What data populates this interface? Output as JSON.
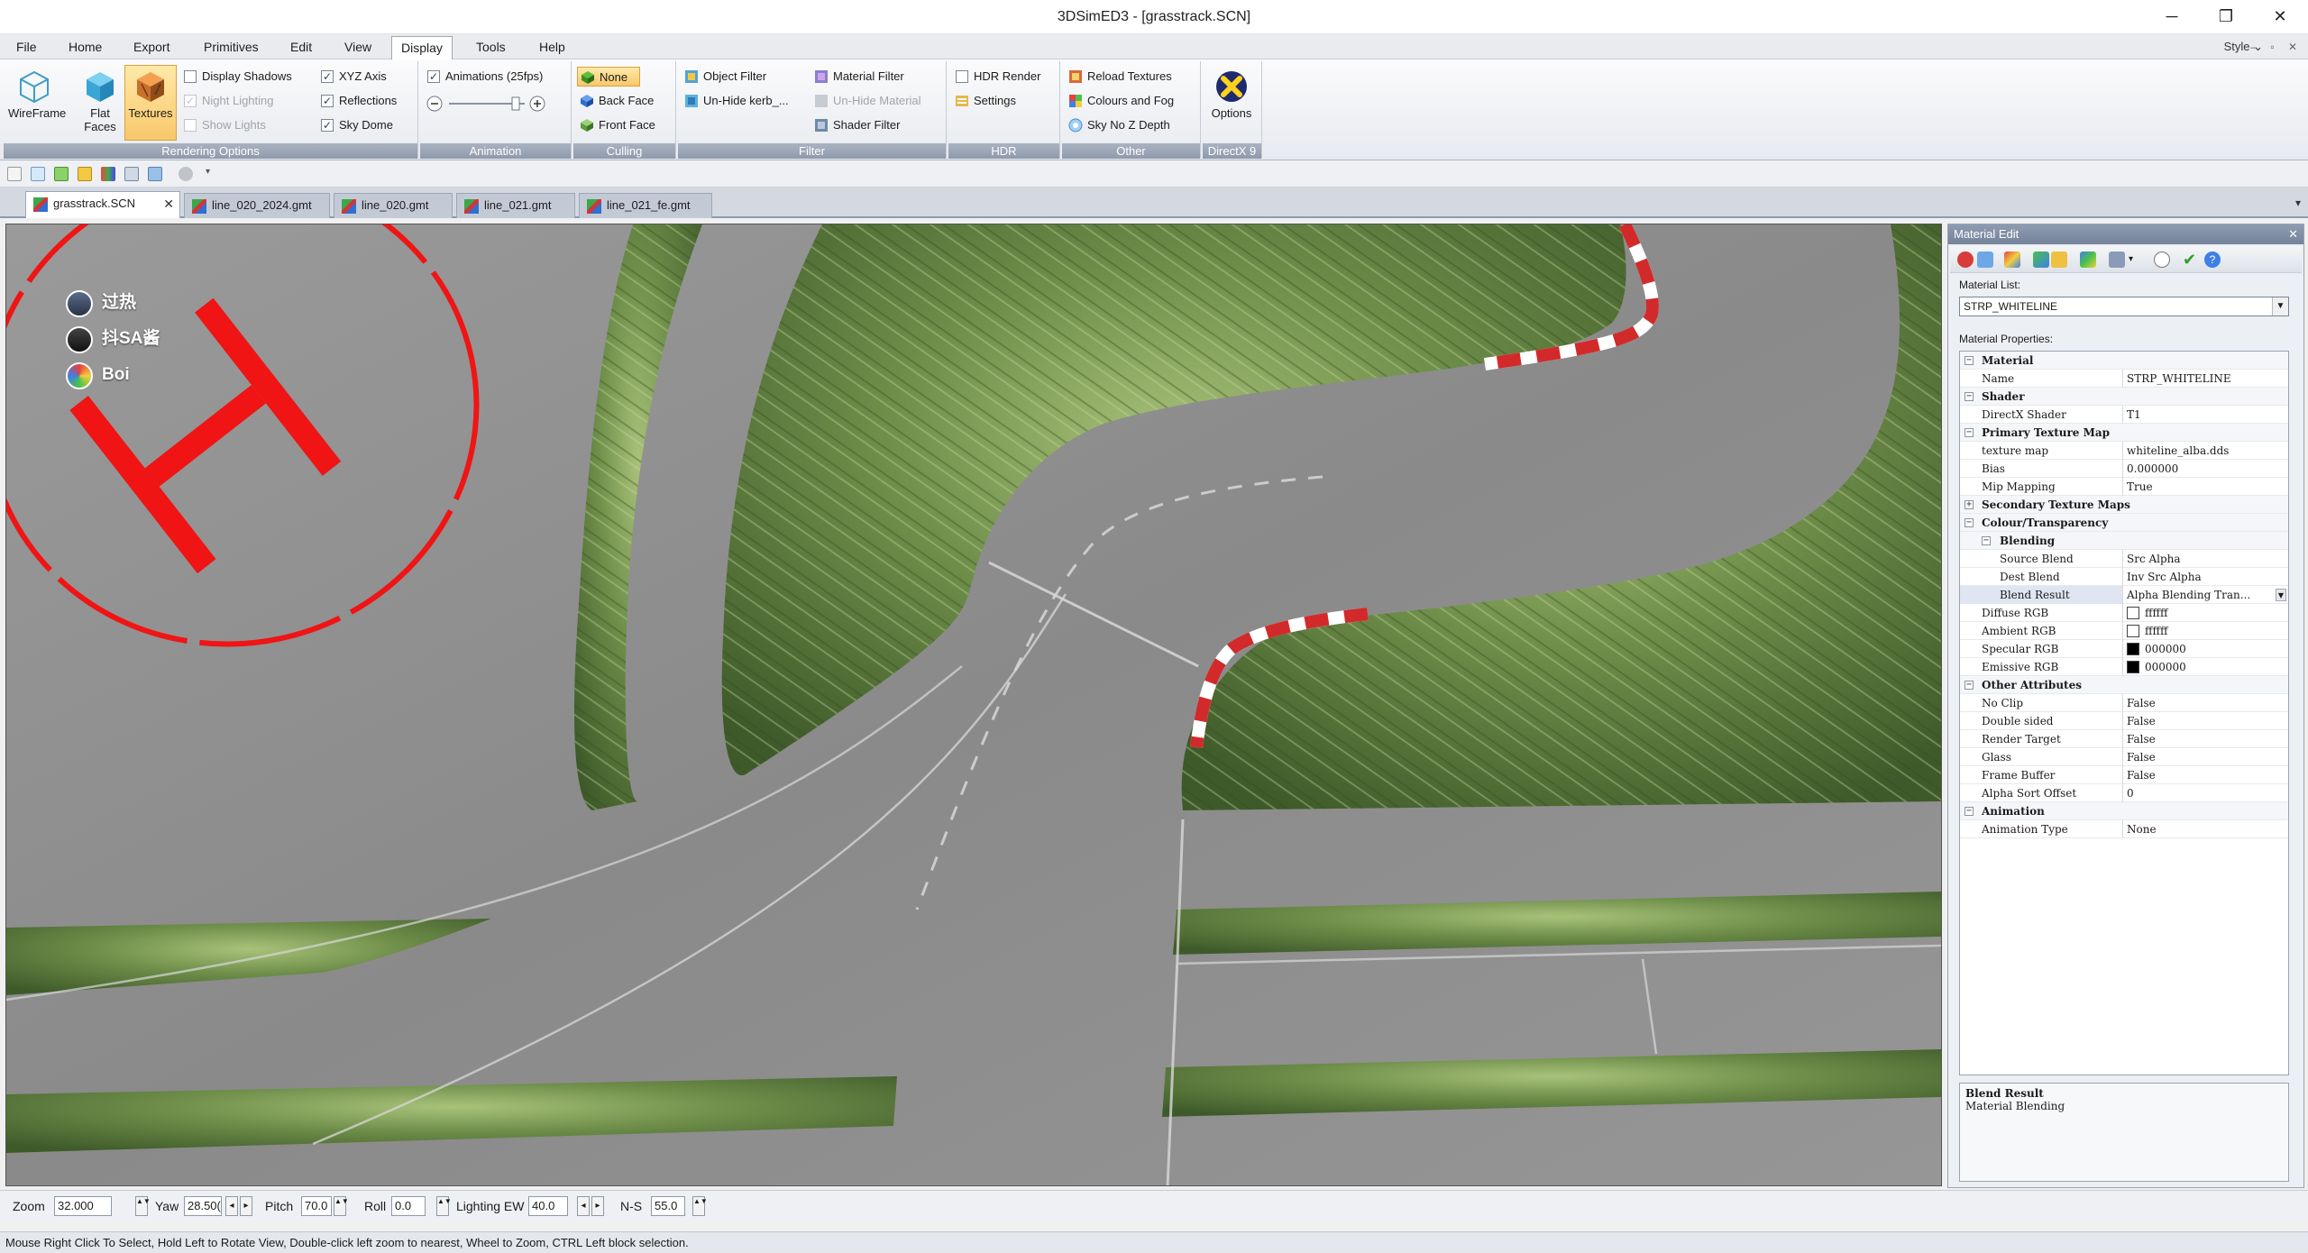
{
  "window": {
    "title": "3DSimED3 - [grasstrack.SCN]",
    "minimize": "─",
    "restore": "❐",
    "close": "✕"
  },
  "menu": {
    "items": [
      "File",
      "Home",
      "Export",
      "Primitives",
      "Edit",
      "View",
      "Display",
      "Tools",
      "Help"
    ],
    "active": "Display",
    "style_label": "Style",
    "style_arrow": "⌄",
    "mini_controls": "‒ ▫ ✕"
  },
  "ribbon": {
    "rendering_options": {
      "label": "Rendering Options",
      "wireframe": "WireFrame",
      "flat_faces": "Flat Faces",
      "textures": "Textures",
      "display_shadows": "Display Shadows",
      "night_lighting": "Night Lighting",
      "show_lights": "Show Lights",
      "xyz_axis": "XYZ Axis",
      "reflections": "Reflections",
      "sky_dome": "Sky Dome",
      "check": "✓"
    },
    "animation": {
      "label": "Animation",
      "animations": "Animations (25fps)"
    },
    "culling": {
      "label": "Culling",
      "none": "None",
      "back_face": "Back Face",
      "front_face": "Front Face"
    },
    "filter": {
      "label": "Filter",
      "object_filter": "Object Filter",
      "unhide_kerb": "Un-Hide kerb_...",
      "material_filter": "Material Filter",
      "unhide_material": "Un-Hide Material",
      "shader_filter": "Shader Filter"
    },
    "hdr": {
      "label": "HDR",
      "hdr_render": "HDR Render",
      "settings": "Settings"
    },
    "other": {
      "label": "Other",
      "reload_textures": "Reload Textures",
      "colours_and_fog": "Colours and Fog",
      "sky_no_z_depth": "Sky No Z Depth"
    },
    "directx": {
      "label": "DirectX 9",
      "options": "Options"
    }
  },
  "tabs": {
    "items": [
      "grasstrack.SCN",
      "line_020_2024.gmt",
      "line_020.gmt",
      "line_021.gmt",
      "line_021_fe.gmt"
    ],
    "close": "✕",
    "menu_arrow": "▾"
  },
  "viewport": {
    "viewers": [
      "过热",
      "抖SA酱",
      "Boi"
    ]
  },
  "material_edit": {
    "title": "Material Edit",
    "close": "✕",
    "material_list_label": "Material List:",
    "material_list_value": "STRP_WHITELINE",
    "properties_label": "Material Properties:",
    "rows": [
      {
        "name": "Material",
        "value": "",
        "kind": "cat",
        "exp": "−"
      },
      {
        "name": "Name",
        "value": "STRP_WHITELINE",
        "kind": "prop"
      },
      {
        "name": "Shader",
        "value": "",
        "kind": "cat",
        "exp": "−"
      },
      {
        "name": "DirectX Shader",
        "value": "T1",
        "kind": "prop"
      },
      {
        "name": "Primary Texture Map",
        "value": "",
        "kind": "cat",
        "exp": "−"
      },
      {
        "name": "texture map",
        "value": "whiteline_alba.dds",
        "kind": "prop"
      },
      {
        "name": "Bias",
        "value": "0.000000",
        "kind": "prop"
      },
      {
        "name": "Mip Mapping",
        "value": "True",
        "kind": "prop"
      },
      {
        "name": "Secondary Texture Maps",
        "value": "",
        "kind": "cat",
        "exp": "+"
      },
      {
        "name": "Colour/Transparency",
        "value": "",
        "kind": "cat",
        "exp": "−"
      },
      {
        "name": "Blending",
        "value": "",
        "kind": "sub",
        "exp": "−"
      },
      {
        "name": "Source Blend",
        "value": "Src Alpha",
        "kind": "deep"
      },
      {
        "name": "Dest Blend",
        "value": "Inv Src Alpha",
        "kind": "deep"
      },
      {
        "name": "Blend Result",
        "value": "Alpha Blending Tran...",
        "kind": "deep",
        "selected": true
      },
      {
        "name": "Diffuse RGB",
        "value": "ffffff",
        "kind": "color",
        "swatch": "#ffffff"
      },
      {
        "name": "Ambient RGB",
        "value": "ffffff",
        "kind": "color",
        "swatch": "#ffffff"
      },
      {
        "name": "Specular RGB",
        "value": "000000",
        "kind": "color",
        "swatch": "#000000"
      },
      {
        "name": "Emissive RGB",
        "value": "000000",
        "kind": "color",
        "swatch": "#000000"
      },
      {
        "name": "Other Attributes",
        "value": "",
        "kind": "cat",
        "exp": "−"
      },
      {
        "name": "No Clip",
        "value": "False",
        "kind": "prop"
      },
      {
        "name": "Double sided",
        "value": "False",
        "kind": "prop"
      },
      {
        "name": "Render Target",
        "value": "False",
        "kind": "prop"
      },
      {
        "name": "Glass",
        "value": "False",
        "kind": "prop"
      },
      {
        "name": "Frame Buffer",
        "value": "False",
        "kind": "prop"
      },
      {
        "name": "Alpha Sort Offset",
        "value": "0",
        "kind": "prop"
      },
      {
        "name": "Animation",
        "value": "",
        "kind": "cat",
        "exp": "−"
      },
      {
        "name": "Animation Type",
        "value": "None",
        "kind": "prop"
      }
    ],
    "desc_title": "Blend Result",
    "desc_text": "Material Blending"
  },
  "nav": {
    "zoom_label": "Zoom",
    "zoom": "32.000",
    "yaw_label": "Yaw",
    "yaw": "28.50(",
    "pitch_label": "Pitch",
    "pitch": "70.0",
    "roll_label": "Roll",
    "roll": "0.0",
    "lighting_ew_label": "Lighting EW",
    "lighting_ew": "40.0",
    "ns_label": "N-S",
    "ns": "55.0",
    "spin_glyph": "▲▼",
    "left_arrow": "◂",
    "right_arrow": "▸"
  },
  "status": {
    "text": "Mouse Right Click To Select, Hold Left to Rotate View, Double-click left  zoom to nearest, Wheel to Zoom, CTRL Left block selection."
  },
  "colors": {
    "grass_dark": "#4f6a33",
    "grass_light": "#8fae62",
    "asphalt": "#8d8d8d",
    "kerb_red": "#d22a2a",
    "helipad_red": "#f01414",
    "selected_orange": "#f8c86a"
  }
}
